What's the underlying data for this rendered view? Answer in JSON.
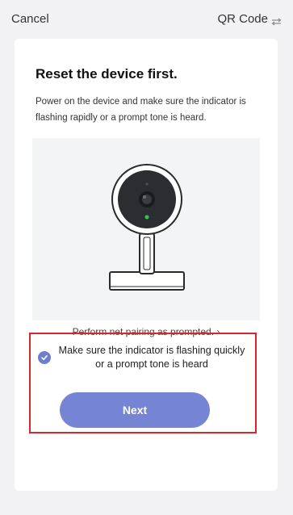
{
  "header": {
    "cancel_label": "Cancel",
    "qr_label": "QR Code",
    "qr_icon": "qr-switch-icon"
  },
  "main": {
    "title": "Reset the device first.",
    "description": "Power on the device and make sure the indicator is flashing rapidly or a prompt tone is heard.",
    "illustration": "security-camera-illustration",
    "pair_link_label": "Perform net pairing as prompted. ›"
  },
  "confirm": {
    "checked": true,
    "label": "Make sure the indicator is flashing quickly or a prompt tone is heard",
    "next_label": "Next"
  },
  "colors": {
    "accent": "#7585d4",
    "check": "#6f7fd0",
    "highlight_border": "#d9262c",
    "indicator_led": "#2ec45a"
  }
}
